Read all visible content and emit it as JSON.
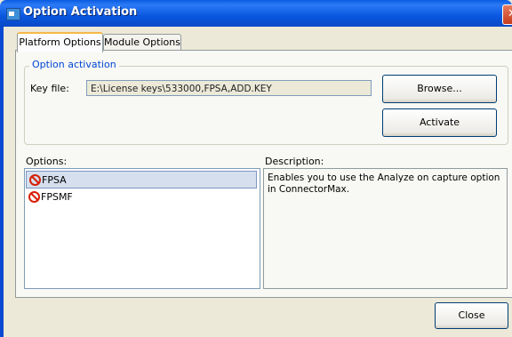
{
  "window": {
    "title": "Option Activation",
    "close_glyph": "✕"
  },
  "tabs": [
    {
      "label": "Platform Options",
      "active": true
    },
    {
      "label": "Module Options",
      "active": false
    }
  ],
  "activation": {
    "group_label": "Option activation",
    "keyfile_label": "Key file:",
    "keyfile_value": "E:\\License keys\\533000,FPSA,ADD.KEY",
    "browse_label": "Browse...",
    "activate_label": "Activate"
  },
  "options": {
    "label": "Options:",
    "items": [
      {
        "name": "FPSA",
        "selected": true,
        "icon": "not-activated-icon"
      },
      {
        "name": "FPSMF",
        "selected": false,
        "icon": "not-activated-icon"
      }
    ]
  },
  "description": {
    "label": "Description:",
    "text": "Enables you to use the Analyze on capture option in ConnectorMax."
  },
  "footer": {
    "close_label": "Close"
  }
}
